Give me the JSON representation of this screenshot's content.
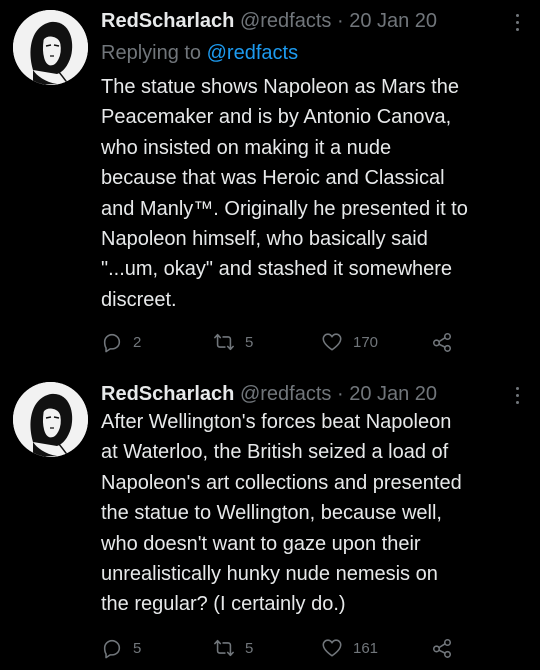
{
  "tweets": [
    {
      "name": "RedScharlach",
      "handle": "@redfacts",
      "dot": "·",
      "date": "20 Jan 20",
      "replying_prefix": "Replying to",
      "replying_to": "@redfacts",
      "text": "The statue shows Napoleon as Mars the\nPeacemaker and is by Antonio Canova,\nwho insisted on making it a nude\nbecause that was Heroic and Classical\nand Manly™. Originally he presented it to\nNapoleon himself, who basically said\n\"...um, okay\" and stashed it somewhere\ndiscreet.",
      "replies": "2",
      "retweets": "5",
      "likes": "170"
    },
    {
      "name": "RedScharlach",
      "handle": "@redfacts",
      "dot": "·",
      "date": "20 Jan 20",
      "text": "After Wellington's forces beat Napoleon\nat Waterloo, the British seized a load of\nNapoleon's art collections and presented\nthe statue to Wellington, because well,\nwho doesn't want to gaze upon their\nunrealistically hunky nude nemesis on\nthe regular? (I certainly do.)",
      "replies": "5",
      "retweets": "5",
      "likes": "161"
    }
  ],
  "icons": {
    "reply": "reply-icon",
    "retweet": "retweet-icon",
    "like": "heart-icon",
    "share": "share-icon",
    "more": "more-icon"
  },
  "colors": {
    "background": "#000000",
    "text": "#e7e9ea",
    "secondary": "#71767b",
    "link": "#1d9bf0"
  }
}
